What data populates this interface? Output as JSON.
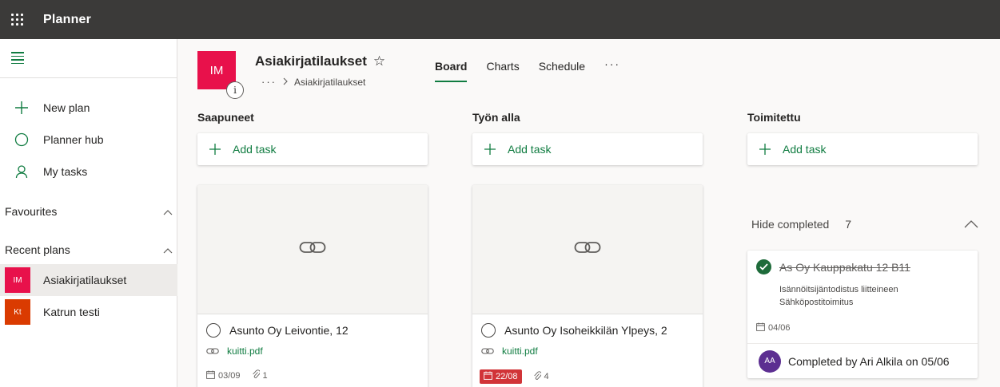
{
  "app": {
    "name": "Planner"
  },
  "sidebar": {
    "nav": [
      {
        "label": "New plan",
        "icon": "plus-icon"
      },
      {
        "label": "Planner hub",
        "icon": "circle-icon"
      },
      {
        "label": "My tasks",
        "icon": "person-icon"
      }
    ],
    "favourites_label": "Favourites",
    "recent_label": "Recent plans",
    "recent_plans": [
      {
        "initials": "IM",
        "name": "Asiakirjatilaukset",
        "color": "#e8114b"
      },
      {
        "initials": "Kt",
        "name": "Katrun testi",
        "color": "#da3b01"
      }
    ]
  },
  "plan": {
    "initials": "IM",
    "title": "Asiakirjatilaukset",
    "breadcrumb": "Asiakirjatilaukset",
    "info_glyph": "i",
    "color": "#e8114b"
  },
  "tabs": [
    {
      "label": "Board",
      "active": true
    },
    {
      "label": "Charts"
    },
    {
      "label": "Schedule"
    }
  ],
  "buckets": [
    {
      "name": "Saapuneet",
      "add_label": "Add task",
      "tasks": [
        {
          "title": "Asunto Oy Leivontie, 12",
          "attachment": "kuitti.pdf",
          "due": "03/09",
          "late": false,
          "attachments_count": "1"
        }
      ]
    },
    {
      "name": "Työn alla",
      "add_label": "Add task",
      "tasks": [
        {
          "title": "Asunto Oy Isoheikkilän Ylpeys, 2",
          "attachment": "kuitti.pdf",
          "due": "22/08",
          "late": true,
          "attachments_count": "4"
        }
      ]
    },
    {
      "name": "Toimitettu",
      "add_label": "Add task",
      "hide_completed_label": "Hide completed",
      "completed_count": "7",
      "completed_task": {
        "title": "As Oy Kauppakatu 12 B11",
        "notes": [
          "Isännöitsijäntodistus liitteineen",
          "Sähköpostitoimitus"
        ],
        "due": "04/06",
        "avatar_initials": "AA",
        "completed_by": "Completed by Ari Alkila on 05/06"
      }
    }
  ],
  "colors": {
    "accent": "#107c41",
    "topbar": "#3b3a39",
    "late": "#d13438",
    "avatar": "#5c2e91"
  }
}
